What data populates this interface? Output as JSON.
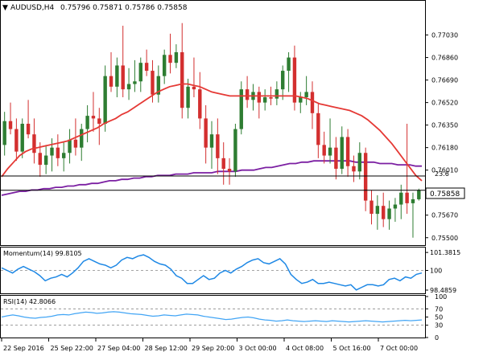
{
  "header": {
    "symbol_tf": "AUDUSD,H4",
    "ohlc": "0.75796 0.75871 0.75786 0.75858"
  },
  "colors": {
    "bull": "#2e7d32",
    "bear": "#d32f2f",
    "sma_fast": "#e53935",
    "sma_slow": "#7b1fa2",
    "momentum": "#1e88e5",
    "rsi": "#42a5f5",
    "hline": "#000000"
  },
  "chart_data": [
    {
      "type": "candlestick",
      "title": "AUDUSD,H4",
      "y_ticks": [
        "0.77030",
        "0.76860",
        "0.76690",
        "0.76520",
        "0.76350",
        "0.76180",
        "0.76010",
        "0.75840",
        "0.75670",
        "0.75500"
      ],
      "ylim": [
        0.7545,
        0.7727
      ],
      "x_ticks": [
        "22 Sep 2016",
        "25 Sep 22:00",
        "27 Sep 04:00",
        "28 Sep 12:00",
        "29 Sep 20:00",
        "3 Oct 00:00",
        "4 Oct 08:00",
        "5 Oct 16:00",
        "7 Oct 00:00"
      ],
      "current_price": "0.75858",
      "current_price_value": 0.75858,
      "fib_label": "23.6",
      "fib_value": 0.76,
      "fib_line_value": 0.75966,
      "candles": [
        [
          0.762,
          0.7645,
          0.7612,
          0.7638
        ],
        [
          0.7638,
          0.7652,
          0.7628,
          0.7632
        ],
        [
          0.7632,
          0.764,
          0.7608,
          0.7615
        ],
        [
          0.7615,
          0.764,
          0.761,
          0.7636
        ],
        [
          0.7636,
          0.7654,
          0.7625,
          0.7628
        ],
        [
          0.7628,
          0.764,
          0.7606,
          0.7614
        ],
        [
          0.7614,
          0.7622,
          0.7596,
          0.7605
        ],
        [
          0.7605,
          0.762,
          0.7598,
          0.7612
        ],
        [
          0.7612,
          0.7625,
          0.76,
          0.7618
        ],
        [
          0.7618,
          0.7628,
          0.7604,
          0.761
        ],
        [
          0.761,
          0.7622,
          0.76,
          0.7614
        ],
        [
          0.7614,
          0.7632,
          0.7606,
          0.7624
        ],
        [
          0.7624,
          0.764,
          0.7612,
          0.7618
        ],
        [
          0.7618,
          0.7636,
          0.7608,
          0.7632
        ],
        [
          0.7632,
          0.765,
          0.7622,
          0.7642
        ],
        [
          0.7642,
          0.766,
          0.763,
          0.764
        ],
        [
          0.764,
          0.7648,
          0.762,
          0.7636
        ],
        [
          0.7636,
          0.768,
          0.763,
          0.7672
        ],
        [
          0.7672,
          0.769,
          0.766,
          0.7664
        ],
        [
          0.7664,
          0.7686,
          0.7656,
          0.768
        ],
        [
          0.768,
          0.771,
          0.7656,
          0.7662
        ],
        [
          0.7662,
          0.7678,
          0.7654,
          0.7666
        ],
        [
          0.7666,
          0.7684,
          0.766,
          0.7668
        ],
        [
          0.7668,
          0.7686,
          0.766,
          0.7682
        ],
        [
          0.7682,
          0.7692,
          0.7672,
          0.7676
        ],
        [
          0.7676,
          0.7684,
          0.7652,
          0.7658
        ],
        [
          0.7658,
          0.768,
          0.7652,
          0.7672
        ],
        [
          0.7672,
          0.7692,
          0.7666,
          0.7688
        ],
        [
          0.7688,
          0.7704,
          0.7674,
          0.7682
        ],
        [
          0.7682,
          0.7696,
          0.7678,
          0.769
        ],
        [
          0.769,
          0.7712,
          0.764,
          0.7648
        ],
        [
          0.7648,
          0.767,
          0.764,
          0.7664
        ],
        [
          0.7664,
          0.7686,
          0.7656,
          0.7662
        ],
        [
          0.7662,
          0.7675,
          0.7632,
          0.764
        ],
        [
          0.764,
          0.765,
          0.7606,
          0.7618
        ],
        [
          0.7618,
          0.7638,
          0.7602,
          0.7628
        ],
        [
          0.7628,
          0.764,
          0.7598,
          0.761
        ],
        [
          0.761,
          0.7622,
          0.759,
          0.7602
        ],
        [
          0.7602,
          0.761,
          0.759,
          0.76
        ],
        [
          0.76,
          0.7636,
          0.7596,
          0.7632
        ],
        [
          0.7632,
          0.7668,
          0.7628,
          0.7662
        ],
        [
          0.7662,
          0.7672,
          0.7648,
          0.7654
        ],
        [
          0.7654,
          0.7666,
          0.7646,
          0.766
        ],
        [
          0.766,
          0.7664,
          0.764,
          0.7652
        ],
        [
          0.7652,
          0.7662,
          0.7646,
          0.7656
        ],
        [
          0.7656,
          0.7664,
          0.765,
          0.7655
        ],
        [
          0.7655,
          0.7668,
          0.765,
          0.7662
        ],
        [
          0.7662,
          0.768,
          0.7654,
          0.7676
        ],
        [
          0.7676,
          0.769,
          0.766,
          0.7686
        ],
        [
          0.7686,
          0.7695,
          0.7646,
          0.7652
        ],
        [
          0.7652,
          0.766,
          0.7644,
          0.7656
        ],
        [
          0.7656,
          0.7672,
          0.765,
          0.766
        ],
        [
          0.766,
          0.7668,
          0.7632,
          0.7644
        ],
        [
          0.7644,
          0.7652,
          0.761,
          0.762
        ],
        [
          0.762,
          0.763,
          0.7606,
          0.7612
        ],
        [
          0.7612,
          0.764,
          0.7606,
          0.7618
        ],
        [
          0.7618,
          0.7626,
          0.7594,
          0.7602
        ],
        [
          0.7602,
          0.7634,
          0.7598,
          0.7626
        ],
        [
          0.7626,
          0.7632,
          0.7596,
          0.7604
        ],
        [
          0.7604,
          0.7612,
          0.7592,
          0.76
        ],
        [
          0.76,
          0.7622,
          0.7594,
          0.7614
        ],
        [
          0.7614,
          0.7618,
          0.757,
          0.7578
        ],
        [
          0.7578,
          0.7586,
          0.756,
          0.7568
        ],
        [
          0.7568,
          0.7582,
          0.7556,
          0.7574
        ],
        [
          0.7574,
          0.7584,
          0.7558,
          0.7564
        ],
        [
          0.7564,
          0.7578,
          0.7556,
          0.7572
        ],
        [
          0.7572,
          0.758,
          0.7562,
          0.7575
        ],
        [
          0.7575,
          0.759,
          0.7564,
          0.7584
        ],
        [
          0.7584,
          0.7636,
          0.7568,
          0.7576
        ],
        [
          0.7576,
          0.7584,
          0.755,
          0.7579
        ],
        [
          0.7579,
          0.7587,
          0.7578,
          0.7586
        ]
      ],
      "sma_fast_values": [
        0.7596,
        0.7602,
        0.7607,
        0.7612,
        0.7615,
        0.7617,
        0.7618,
        0.7619,
        0.762,
        0.7621,
        0.7622,
        0.7623,
        0.7625,
        0.7627,
        0.7629,
        0.7631,
        0.7633,
        0.7636,
        0.7638,
        0.764,
        0.7643,
        0.7645,
        0.7648,
        0.7651,
        0.7654,
        0.7657,
        0.766,
        0.7662,
        0.7664,
        0.7665,
        0.7666,
        0.7666,
        0.7665,
        0.7664,
        0.7662,
        0.766,
        0.7659,
        0.7658,
        0.7657,
        0.7657,
        0.7657,
        0.7657,
        0.7657,
        0.7657,
        0.7657,
        0.7657,
        0.7657,
        0.7657,
        0.7657,
        0.7657,
        0.7656,
        0.7655,
        0.7653,
        0.7651,
        0.765,
        0.7649,
        0.7648,
        0.7647,
        0.7646,
        0.7644,
        0.7642,
        0.7639,
        0.7635,
        0.7631,
        0.7626,
        0.7621,
        0.7615,
        0.7609,
        0.7603,
        0.7597,
        0.7593
      ],
      "sma_slow_values": [
        0.7582,
        0.7583,
        0.7584,
        0.7585,
        0.7585,
        0.7586,
        0.7586,
        0.7587,
        0.7587,
        0.7588,
        0.7588,
        0.7589,
        0.7589,
        0.759,
        0.759,
        0.7591,
        0.7591,
        0.7592,
        0.7593,
        0.7593,
        0.7594,
        0.7594,
        0.7595,
        0.7595,
        0.7596,
        0.7596,
        0.7597,
        0.7597,
        0.7597,
        0.7598,
        0.7598,
        0.7598,
        0.7599,
        0.7599,
        0.7599,
        0.7599,
        0.76,
        0.76,
        0.76,
        0.76,
        0.7601,
        0.7601,
        0.7601,
        0.7602,
        0.7603,
        0.7603,
        0.7604,
        0.7605,
        0.7606,
        0.7606,
        0.7607,
        0.7607,
        0.7608,
        0.7608,
        0.7608,
        0.7608,
        0.7608,
        0.7608,
        0.7608,
        0.7607,
        0.7607,
        0.7607,
        0.7607,
        0.7606,
        0.7606,
        0.7606,
        0.7605,
        0.7605,
        0.7605,
        0.7604,
        0.7604
      ]
    },
    {
      "type": "line",
      "title": "Momentum(14) 99.8105",
      "y_ticks": [
        "101.3815",
        "100",
        "98.4859"
      ],
      "ylim": [
        98.3,
        101.7
      ],
      "ref_line": 100,
      "values": [
        100.2,
        100.0,
        99.8,
        100.1,
        100.3,
        100.1,
        99.9,
        99.6,
        99.2,
        99.4,
        99.5,
        99.7,
        99.5,
        99.8,
        100.2,
        100.7,
        100.9,
        100.7,
        100.5,
        100.4,
        100.2,
        100.4,
        100.8,
        101.0,
        100.9,
        101.1,
        101.2,
        101.0,
        100.7,
        100.5,
        100.4,
        100.1,
        99.6,
        99.4,
        99.0,
        99.0,
        99.3,
        99.6,
        99.3,
        99.4,
        99.8,
        100.0,
        99.8,
        100.1,
        100.3,
        100.6,
        100.8,
        100.9,
        100.6,
        100.5,
        100.7,
        100.9,
        100.5,
        99.7,
        99.3,
        99.0,
        99.1,
        99.3,
        99.0,
        99.0,
        99.1,
        99.0,
        98.9,
        98.8,
        98.9,
        98.5,
        98.7,
        98.9,
        98.9,
        98.8,
        98.9,
        99.3,
        99.4,
        99.2,
        99.5,
        99.4,
        99.7,
        99.8
      ]
    },
    {
      "type": "line",
      "title": "RSI(14) 42.8066",
      "y_ticks": [
        "100",
        "70",
        "50",
        "30",
        "0"
      ],
      "ylim": [
        0,
        100
      ],
      "levels": [
        70,
        30
      ],
      "values": [
        50,
        53,
        55,
        53,
        50,
        48,
        47,
        49,
        50,
        52,
        55,
        56,
        55,
        58,
        60,
        62,
        61,
        59,
        60,
        62,
        63,
        62,
        60,
        58,
        57,
        56,
        54,
        52,
        53,
        55,
        54,
        53,
        55,
        57,
        56,
        55,
        52,
        50,
        48,
        46,
        44,
        45,
        47,
        49,
        50,
        48,
        45,
        43,
        42,
        40,
        41,
        43,
        41,
        40,
        39,
        40,
        41,
        40,
        39,
        41,
        40,
        39,
        38,
        39,
        40,
        41,
        40,
        39,
        38,
        39,
        40,
        41,
        42,
        41,
        42,
        43
      ]
    }
  ]
}
